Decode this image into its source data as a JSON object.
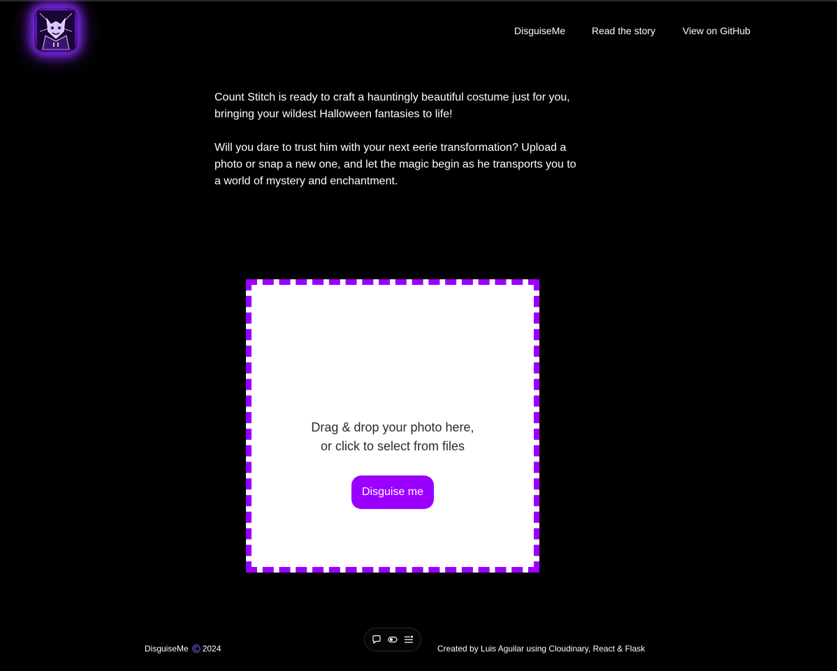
{
  "header": {
    "logo_icon": "count-stitch-vampire-logo",
    "nav": [
      {
        "label": "DisguiseMe"
      },
      {
        "label": "Read the story"
      },
      {
        "label": "View on GitHub"
      }
    ]
  },
  "intro": {
    "paragraph_1": "Count Stitch is ready to craft a hauntingly beautiful costume just for you, bringing your wildest Halloween fantasies to life!",
    "paragraph_2": "Will you dare to trust him with your next eerie transformation? Upload a photo or snap a new one, and let the magic begin as he transports you to a world of mystery and enchantment."
  },
  "upload": {
    "line_1": "Drag & drop your photo here,",
    "line_2": "or click to select from files",
    "button_label": "Disguise me"
  },
  "toolbar": {
    "icons": [
      "comment-icon",
      "toggle-icon",
      "menu-icon"
    ]
  },
  "footer": {
    "brand": "DisguiseMe",
    "copyright_icon": "copyright-icon",
    "year": "2024",
    "credits": "Created by Luis Aguilar using Cloudinary, React & Flask"
  },
  "colors": {
    "accent": "#9b00ff",
    "background": "#000000",
    "dropzone_bg": "#ffffff"
  }
}
